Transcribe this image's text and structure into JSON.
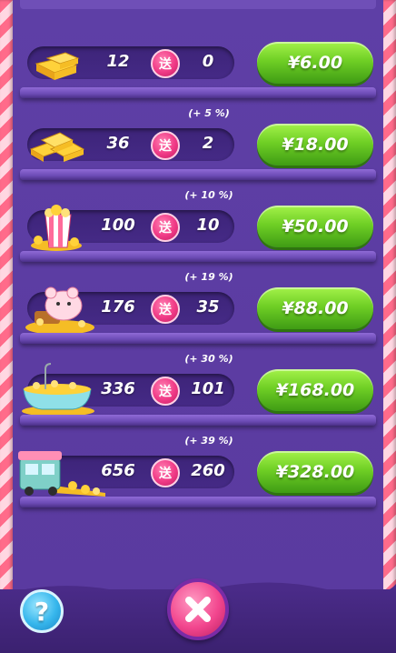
{
  "rows": [
    {
      "base": "12",
      "gift": "送",
      "bonus": "0",
      "percent": "",
      "price": "¥6.00",
      "item_icon": "gold-bars-small-icon"
    },
    {
      "base": "36",
      "gift": "送",
      "bonus": "2",
      "percent": "(+ 5 %)",
      "price": "¥18.00",
      "item_icon": "gold-bars-pile-icon"
    },
    {
      "base": "100",
      "gift": "送",
      "bonus": "10",
      "percent": "(+ 10 %)",
      "price": "¥50.00",
      "item_icon": "popcorn-box-icon"
    },
    {
      "base": "176",
      "gift": "送",
      "bonus": "35",
      "percent": "(+ 19 %)",
      "price": "¥88.00",
      "item_icon": "piggy-gold-icon"
    },
    {
      "base": "336",
      "gift": "送",
      "bonus": "101",
      "percent": "(+ 30 %)",
      "price": "¥168.00",
      "item_icon": "bathtub-gold-icon"
    },
    {
      "base": "656",
      "gift": "送",
      "bonus": "260",
      "percent": "(+ 39 %)",
      "price": "¥328.00",
      "item_icon": "truck-gold-icon"
    }
  ],
  "footer": {
    "help_label": "?"
  },
  "colors": {
    "price_button": "#6fcf25",
    "gift_badge": "#f03a86",
    "background": "#5a3a9f",
    "close_button": "#f2468e",
    "help_button": "#36b6ec"
  }
}
